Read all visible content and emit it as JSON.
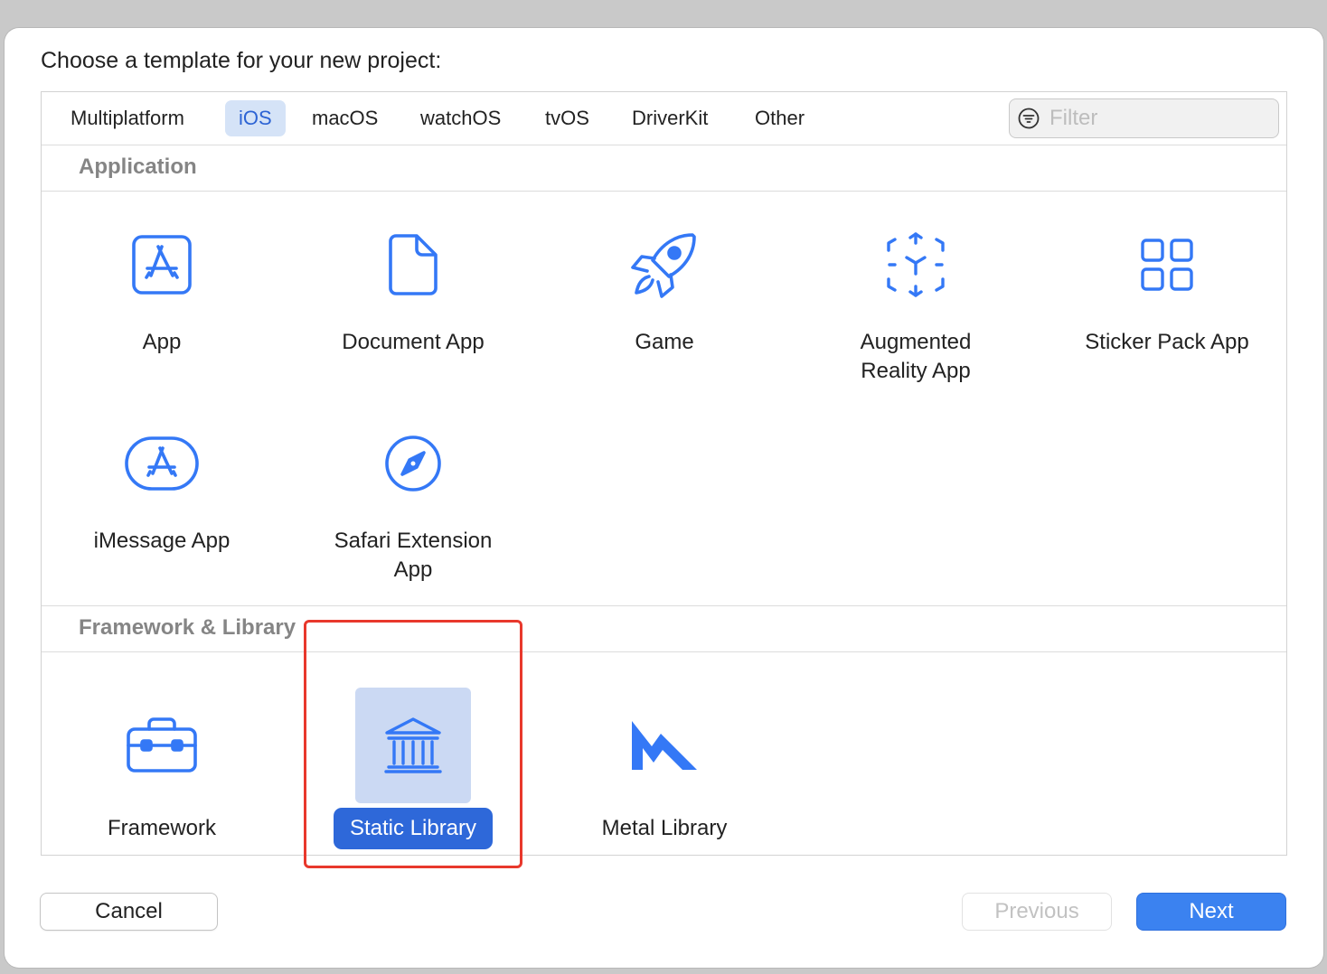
{
  "dialog": {
    "prompt": "Choose a template for your new project:"
  },
  "tabs": [
    {
      "label": "Multiplatform",
      "active": false
    },
    {
      "label": "iOS",
      "active": true
    },
    {
      "label": "macOS",
      "active": false
    },
    {
      "label": "watchOS",
      "active": false
    },
    {
      "label": "tvOS",
      "active": false
    },
    {
      "label": "DriverKit",
      "active": false
    },
    {
      "label": "Other",
      "active": false
    }
  ],
  "filter": {
    "placeholder": "Filter",
    "value": ""
  },
  "sections": [
    {
      "title": "Application",
      "templates": [
        {
          "label": "App",
          "icon": "app-store-icon"
        },
        {
          "label": "Document App",
          "icon": "document-icon"
        },
        {
          "label": "Game",
          "icon": "rocket-icon"
        },
        {
          "label": "Augmented\nReality App",
          "icon": "ar-cube-icon"
        },
        {
          "label": "Sticker Pack App",
          "icon": "grid-icon"
        },
        {
          "label": "iMessage App",
          "icon": "imessage-app-icon"
        },
        {
          "label": "Safari Extension\nApp",
          "icon": "compass-icon"
        }
      ]
    },
    {
      "title": "Framework & Library",
      "templates": [
        {
          "label": "Framework",
          "icon": "toolbox-icon"
        },
        {
          "label": "Static Library",
          "icon": "building-columns-icon",
          "selected": true
        },
        {
          "label": "Metal Library",
          "icon": "metal-icon"
        }
      ]
    }
  ],
  "buttons": {
    "cancel": "Cancel",
    "previous": "Previous",
    "next": "Next",
    "previous_enabled": false
  },
  "colors": {
    "accent": "#3b82f0",
    "selection": "#2e68d9",
    "icon": "#3478f6",
    "highlight_box": "#e8382c"
  }
}
